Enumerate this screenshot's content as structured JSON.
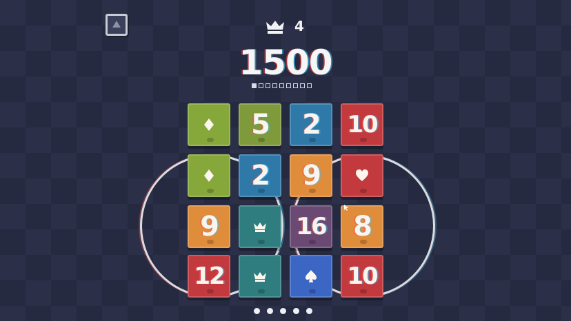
{
  "header": {
    "best_score": "4",
    "score": "1500",
    "progress_total": 9,
    "progress_filled": 1
  },
  "board": {
    "tiles": [
      {
        "value": "",
        "symbol": "diamond",
        "color": "#86a83a"
      },
      {
        "value": "5",
        "symbol": "",
        "color": "#7e9a3b"
      },
      {
        "value": "2",
        "symbol": "",
        "color": "#2f79a9"
      },
      {
        "value": "10",
        "symbol": "",
        "color": "#c23a3e"
      },
      {
        "value": "",
        "symbol": "diamond",
        "color": "#86a83a"
      },
      {
        "value": "2",
        "symbol": "",
        "color": "#2f79a9"
      },
      {
        "value": "9",
        "symbol": "",
        "color": "#e08d3b"
      },
      {
        "value": "",
        "symbol": "heart",
        "color": "#c23a3e"
      },
      {
        "value": "9",
        "symbol": "",
        "color": "#e08d3b"
      },
      {
        "value": "",
        "symbol": "crown",
        "color": "#2f7d7f"
      },
      {
        "value": "16",
        "symbol": "",
        "color": "#6a4a73"
      },
      {
        "value": "8",
        "symbol": "",
        "color": "#e08d3b"
      },
      {
        "value": "12",
        "symbol": "",
        "color": "#c23a3e"
      },
      {
        "value": "",
        "symbol": "crown",
        "color": "#2f7d7f"
      },
      {
        "value": "",
        "symbol": "spade",
        "color": "#3b66c4"
      },
      {
        "value": "10",
        "symbol": "",
        "color": "#c23a3e"
      }
    ]
  },
  "pager": {
    "count": 5
  },
  "icons": {
    "menu": "triangle-up-icon",
    "best": "crown-icon"
  }
}
